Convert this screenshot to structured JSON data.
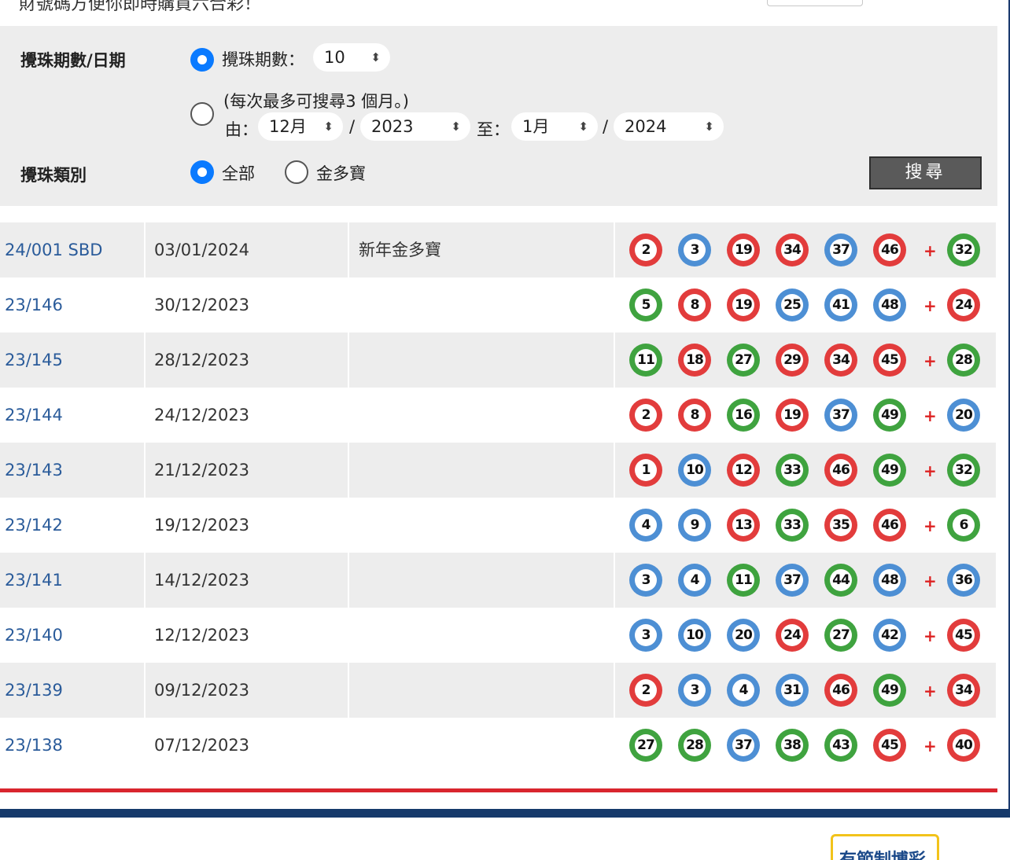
{
  "header": {
    "clipped_text": "財號碼方便你即時購買六合彩！"
  },
  "filters": {
    "period_label": "攪珠期數/日期",
    "by_count_label": "攪珠期數：",
    "count_value": "10",
    "note": "(每次最多可搜尋3 個月。)",
    "from_label": "由：",
    "from_month": "12月",
    "from_separator": "/",
    "from_year": "2023",
    "to_label": "至：",
    "to_month": "1月",
    "to_separator": "/",
    "to_year": "2024",
    "type_label": "攪珠類別",
    "type_all": "全部",
    "type_snowball": "金多寶",
    "search_button": "搜尋",
    "selected_period_mode": "count",
    "selected_type": "all"
  },
  "ball_colors": {
    "red": "#e23c3c",
    "blue": "#4d8fd4",
    "green": "#3fa33f"
  },
  "draws": [
    {
      "draw": "24/001 SBD",
      "date": "03/01/2024",
      "name": "新年金多寶",
      "numbers": [
        2,
        3,
        19,
        34,
        37,
        46
      ],
      "extra": 32
    },
    {
      "draw": "23/146",
      "date": "30/12/2023",
      "name": "",
      "numbers": [
        5,
        8,
        19,
        25,
        41,
        48
      ],
      "extra": 24
    },
    {
      "draw": "23/145",
      "date": "28/12/2023",
      "name": "",
      "numbers": [
        11,
        18,
        27,
        29,
        34,
        45
      ],
      "extra": 28
    },
    {
      "draw": "23/144",
      "date": "24/12/2023",
      "name": "",
      "numbers": [
        2,
        8,
        16,
        19,
        37,
        49
      ],
      "extra": 20
    },
    {
      "draw": "23/143",
      "date": "21/12/2023",
      "name": "",
      "numbers": [
        1,
        10,
        12,
        33,
        46,
        49
      ],
      "extra": 32
    },
    {
      "draw": "23/142",
      "date": "19/12/2023",
      "name": "",
      "numbers": [
        4,
        9,
        13,
        33,
        35,
        46
      ],
      "extra": 6
    },
    {
      "draw": "23/141",
      "date": "14/12/2023",
      "name": "",
      "numbers": [
        3,
        4,
        11,
        37,
        44,
        48
      ],
      "extra": 36
    },
    {
      "draw": "23/140",
      "date": "12/12/2023",
      "name": "",
      "numbers": [
        3,
        10,
        20,
        24,
        27,
        42
      ],
      "extra": 45
    },
    {
      "draw": "23/139",
      "date": "09/12/2023",
      "name": "",
      "numbers": [
        2,
        3,
        4,
        31,
        46,
        49
      ],
      "extra": 34
    },
    {
      "draw": "23/138",
      "date": "07/12/2023",
      "name": "",
      "numbers": [
        27,
        28,
        37,
        38,
        43,
        45
      ],
      "extra": 40
    }
  ],
  "plus_sign": "+",
  "footer": {
    "badge_text": "有節制博彩"
  }
}
